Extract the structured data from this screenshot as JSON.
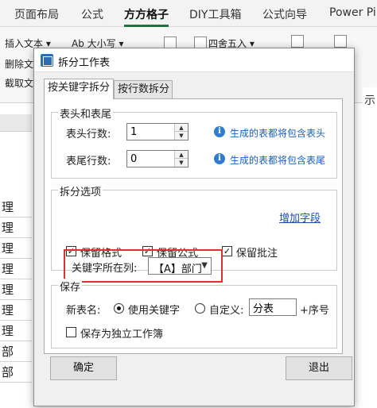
{
  "ribbon": {
    "tabs": [
      "页面布局",
      "公式",
      "方方格子",
      "DIY工具箱",
      "公式向导",
      "Power Pi"
    ],
    "active_tab": "方方格子",
    "items": {
      "insert_text": "插入文本 ▾",
      "case": "Ab 大小写 ▾",
      "round": "四舍五入 ▾",
      "delete_text": "删除文",
      "extract_text": "截取文"
    }
  },
  "sheet": {
    "cells": [
      "理",
      "理",
      "理",
      "理",
      "理",
      "理",
      "理",
      "部",
      "部"
    ]
  },
  "right_fragment": "示",
  "dialog": {
    "title": "拆分工作表",
    "tabs": [
      "按关键字拆分",
      "按行数拆分"
    ],
    "header_footer": {
      "title": "表头和表尾",
      "header_rows_label": "表头行数:",
      "header_rows_value": "1",
      "footer_rows_label": "表尾行数:",
      "footer_rows_value": "0",
      "header_hint": "生成的表都将包含表头",
      "footer_hint": "生成的表都将包含表尾"
    },
    "split_options": {
      "title": "拆分选项",
      "key_column_label": "关键字所在列:",
      "key_column_value": "【A】部门",
      "add_field_link": "增加字段",
      "keep_format": "保留格式",
      "keep_formula": "保留公式",
      "keep_comment": "保留批注"
    },
    "save": {
      "title": "保存",
      "name_label": "新表名:",
      "use_keyword": "使用关键字",
      "custom": "自定义:",
      "custom_value": "分表",
      "suffix": "+序号",
      "save_independent": "保存为独立工作簿"
    },
    "ok_label": "确定",
    "exit_label": "退出"
  },
  "colors": {
    "highlight_border": "#d9342b",
    "link": "#1a4fb5",
    "info": "#2f7dd1"
  }
}
